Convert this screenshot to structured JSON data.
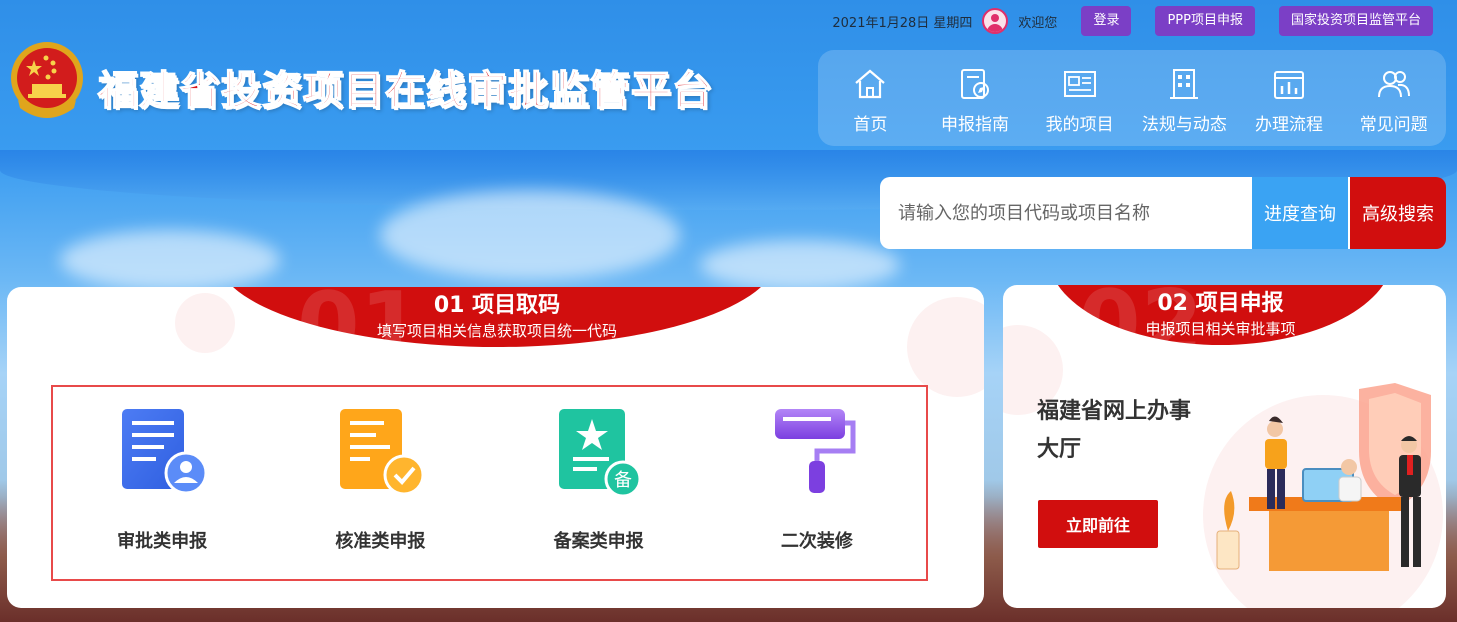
{
  "header": {
    "date": "2021年1月28日 星期四",
    "welcome": "欢迎您",
    "buttons": [
      "登录",
      "PPP项目申报",
      "国家投资项目监管平台"
    ],
    "site_title": "福建省投资项目在线审批监管平台"
  },
  "nav": {
    "items": [
      {
        "label": "首页",
        "icon": "home-icon"
      },
      {
        "label": "申报指南",
        "icon": "guide-icon"
      },
      {
        "label": "我的项目",
        "icon": "project-icon"
      },
      {
        "label": "法规与动态",
        "icon": "building-icon"
      },
      {
        "label": "办理流程",
        "icon": "process-icon"
      },
      {
        "label": "常见问题",
        "icon": "users-icon"
      }
    ]
  },
  "search": {
    "placeholder": "请输入您的项目代码或项目名称",
    "progress_label": "进度查询",
    "advanced_label": "高级搜索"
  },
  "card1": {
    "bg_number": "01",
    "title": "01 项目取码",
    "subtitle": "填写项目相关信息获取项目统一代码",
    "options": [
      {
        "label": "审批类申报",
        "icon": "approval-doc-icon",
        "badge": ""
      },
      {
        "label": "核准类申报",
        "icon": "verify-doc-icon",
        "badge": ""
      },
      {
        "label": "备案类申报",
        "icon": "record-doc-icon",
        "badge": "备"
      },
      {
        "label": "二次装修",
        "icon": "paint-roller-icon",
        "badge": ""
      }
    ]
  },
  "card2": {
    "bg_number": "02",
    "title": "02 项目申报",
    "subtitle": "申报项目相关审批事项",
    "hall_title": "福建省网上办事大厅",
    "go_label": "立即前往"
  },
  "colors": {
    "primary_red": "#d10e0e",
    "top_button_purple": "#7b3fc6",
    "search_blue": "#3aa3f3"
  }
}
